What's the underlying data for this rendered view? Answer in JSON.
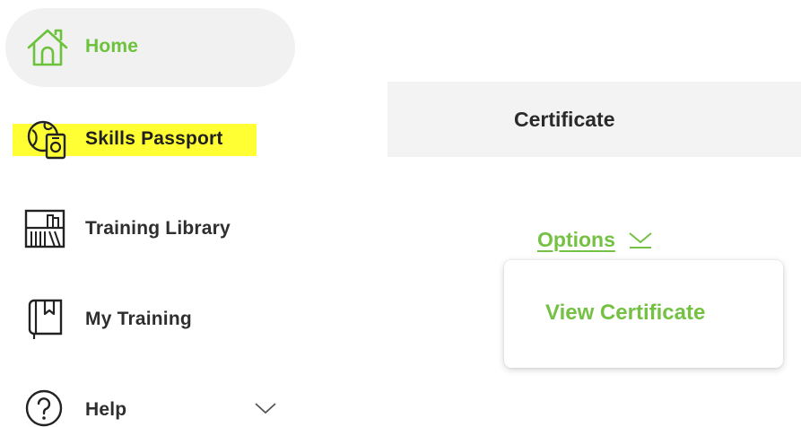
{
  "sidebar": {
    "items": [
      {
        "label": "Home",
        "icon": "home-icon",
        "active": true
      },
      {
        "label": "Skills Passport",
        "icon": "skills-passport-icon",
        "highlighted": true
      },
      {
        "label": "Training Library",
        "icon": "training-library-icon"
      },
      {
        "label": "My Training",
        "icon": "my-training-icon"
      },
      {
        "label": "Help",
        "icon": "help-icon",
        "expandable": true
      }
    ]
  },
  "certificate": {
    "header": "Certificate",
    "options_label": "Options",
    "menu": [
      {
        "label": "View Certificate"
      }
    ]
  },
  "colors": {
    "accent_green": "#6cc23a",
    "highlight_yellow": "#ffff33",
    "active_bg": "#f1f1f1",
    "header_bg": "#f3f3f3"
  }
}
